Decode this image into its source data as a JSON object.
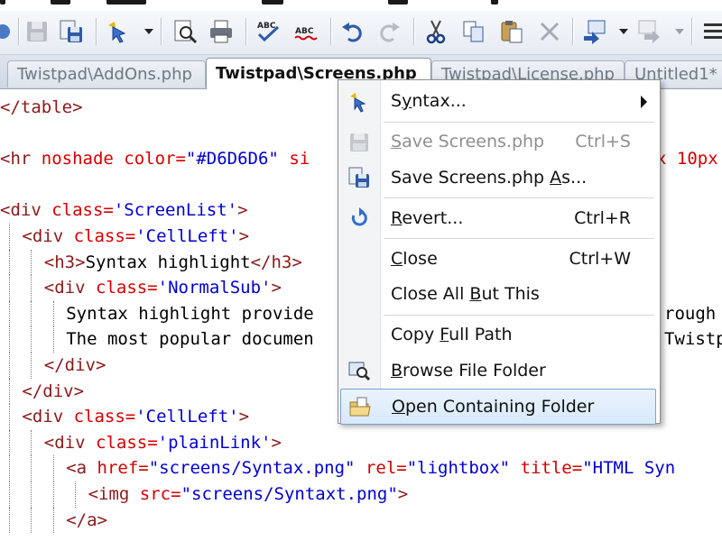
{
  "toolbar": {
    "buttons": [
      {
        "name": "save-icon",
        "state": "disabled"
      },
      {
        "name": "save-all-icon",
        "state": "enabled"
      },
      {
        "name": "syntax-icon",
        "state": "enabled"
      },
      {
        "name": "print-preview-icon",
        "state": "enabled"
      },
      {
        "name": "print-icon",
        "state": "enabled"
      },
      {
        "name": "spell-check-icon",
        "state": "enabled"
      },
      {
        "name": "spell-check-alt-icon",
        "state": "enabled"
      },
      {
        "name": "undo-icon",
        "state": "enabled"
      },
      {
        "name": "redo-icon",
        "state": "disabled"
      },
      {
        "name": "cut-icon",
        "state": "enabled"
      },
      {
        "name": "copy-icon",
        "state": "enabled"
      },
      {
        "name": "paste-icon",
        "state": "enabled"
      },
      {
        "name": "delete-icon",
        "state": "disabled"
      },
      {
        "name": "convert-icon",
        "state": "enabled"
      },
      {
        "name": "convert-alt-icon",
        "state": "disabled"
      },
      {
        "name": "more-icon",
        "state": "enabled"
      }
    ]
  },
  "tabs": [
    {
      "label": "Twistpad\\AddOns.php",
      "active": false
    },
    {
      "label": "Twistpad\\Screens.php",
      "active": true
    },
    {
      "label": "Twistpad\\License.php",
      "active": false
    },
    {
      "label": "Untitled1*",
      "active": false
    }
  ],
  "editor": {
    "lines": [
      {
        "indent": 0,
        "parts": [
          {
            "t": "tag",
            "s": "</table>"
          }
        ]
      },
      {
        "indent": 0,
        "parts": []
      },
      {
        "indent": 0,
        "parts": [
          {
            "t": "tag",
            "s": "<hr "
          },
          {
            "t": "attr",
            "s": "noshade "
          },
          {
            "t": "attr",
            "s": "color="
          },
          {
            "t": "val",
            "s": "\"#D6D6D6\" "
          },
          {
            "t": "attr",
            "s": "si"
          }
        ],
        "tail": "x 10px"
      },
      {
        "indent": 0,
        "parts": []
      },
      {
        "indent": 0,
        "parts": [
          {
            "t": "tag",
            "s": "<div "
          },
          {
            "t": "attr",
            "s": "class="
          },
          {
            "t": "val",
            "s": "'ScreenList'"
          },
          {
            "t": "tag",
            "s": ">"
          }
        ]
      },
      {
        "indent": 1,
        "parts": [
          {
            "t": "tag",
            "s": "<div "
          },
          {
            "t": "attr",
            "s": "class="
          },
          {
            "t": "val",
            "s": "'CellLeft'"
          },
          {
            "t": "tag",
            "s": ">"
          }
        ]
      },
      {
        "indent": 2,
        "parts": [
          {
            "t": "tag",
            "s": "<h3>"
          },
          {
            "t": "txt",
            "s": "Syntax highlight"
          },
          {
            "t": "tag",
            "s": "</h3>"
          }
        ]
      },
      {
        "indent": 2,
        "parts": [
          {
            "t": "tag",
            "s": "<div "
          },
          {
            "t": "attr",
            "s": "class="
          },
          {
            "t": "val",
            "s": "'NormalSub'"
          },
          {
            "t": "tag",
            "s": ">"
          }
        ]
      },
      {
        "indent": 3,
        "parts": [
          {
            "t": "txt",
            "s": "Syntax highlight provide"
          }
        ],
        "tail": "rough"
      },
      {
        "indent": 3,
        "parts": [
          {
            "t": "txt",
            "s": "The most popular documen"
          }
        ],
        "tail": "Twistp"
      },
      {
        "indent": 2,
        "parts": [
          {
            "t": "tag",
            "s": "</div>"
          }
        ]
      },
      {
        "indent": 1,
        "parts": [
          {
            "t": "tag",
            "s": "</div>"
          }
        ]
      },
      {
        "indent": 1,
        "parts": [
          {
            "t": "tag",
            "s": "<div "
          },
          {
            "t": "attr",
            "s": "class="
          },
          {
            "t": "val",
            "s": "'CellLeft'"
          },
          {
            "t": "tag",
            "s": ">"
          }
        ]
      },
      {
        "indent": 2,
        "parts": [
          {
            "t": "tag",
            "s": "<div "
          },
          {
            "t": "attr",
            "s": "class="
          },
          {
            "t": "val",
            "s": "'plainLink'"
          },
          {
            "t": "tag",
            "s": ">"
          }
        ]
      },
      {
        "indent": 3,
        "parts": [
          {
            "t": "tag",
            "s": "<a "
          },
          {
            "t": "attr",
            "s": "href="
          },
          {
            "t": "val",
            "s": "\"screens/Syntax.png\" "
          },
          {
            "t": "attr",
            "s": "rel="
          },
          {
            "t": "val",
            "s": "\"lightbox\" "
          },
          {
            "t": "attr",
            "s": "title="
          },
          {
            "t": "val",
            "s": "\"HTML Syn"
          }
        ]
      },
      {
        "indent": 4,
        "parts": [
          {
            "t": "tag",
            "s": "<img "
          },
          {
            "t": "attr",
            "s": "src="
          },
          {
            "t": "val",
            "s": "\"screens/Syntaxt.png\""
          },
          {
            "t": "tag",
            "s": ">"
          }
        ]
      },
      {
        "indent": 3,
        "parts": [
          {
            "t": "tag",
            "s": "</a>"
          }
        ]
      }
    ]
  },
  "context_menu": {
    "items": [
      {
        "kind": "item",
        "name": "menu-item-syntax",
        "icon": "syntax-icon",
        "pre": "S",
        "u": "y",
        "post": "ntax...",
        "shortcut": "",
        "submenu": true,
        "disabled": false,
        "highlight": false
      },
      {
        "kind": "sep"
      },
      {
        "kind": "item",
        "name": "menu-item-save",
        "icon": "save-icon",
        "pre": "",
        "u": "S",
        "post": "ave Screens.php",
        "shortcut": "Ctrl+S",
        "submenu": false,
        "disabled": true,
        "highlight": false
      },
      {
        "kind": "item",
        "name": "menu-item-save-as",
        "icon": "save-as-icon",
        "pre": "Save Screens.php ",
        "u": "A",
        "post": "s...",
        "shortcut": "",
        "submenu": false,
        "disabled": false,
        "highlight": false
      },
      {
        "kind": "sep"
      },
      {
        "kind": "item",
        "name": "menu-item-revert",
        "icon": "revert-icon",
        "pre": "",
        "u": "R",
        "post": "evert...",
        "shortcut": "Ctrl+R",
        "submenu": false,
        "disabled": false,
        "highlight": false
      },
      {
        "kind": "sep"
      },
      {
        "kind": "item",
        "name": "menu-item-close",
        "icon": "",
        "pre": "",
        "u": "C",
        "post": "lose",
        "shortcut": "Ctrl+W",
        "submenu": false,
        "disabled": false,
        "highlight": false
      },
      {
        "kind": "item",
        "name": "menu-item-close-all-but-this",
        "icon": "",
        "pre": "Close All ",
        "u": "B",
        "post": "ut This",
        "shortcut": "",
        "submenu": false,
        "disabled": false,
        "highlight": false
      },
      {
        "kind": "sep"
      },
      {
        "kind": "item",
        "name": "menu-item-copy-full-path",
        "icon": "",
        "pre": "Copy ",
        "u": "F",
        "post": "ull Path",
        "shortcut": "",
        "submenu": false,
        "disabled": false,
        "highlight": false
      },
      {
        "kind": "item",
        "name": "menu-item-browse-file-folder",
        "icon": "browse-folder-icon",
        "pre": "",
        "u": "B",
        "post": "rowse File Folder",
        "shortcut": "",
        "submenu": false,
        "disabled": false,
        "highlight": false
      },
      {
        "kind": "item",
        "name": "menu-item-open-containing-folder",
        "icon": "open-folder-icon",
        "pre": "",
        "u": "O",
        "post": "pen Containing Folder",
        "shortcut": "",
        "submenu": false,
        "disabled": false,
        "highlight": true
      }
    ]
  },
  "colors": {
    "tag": "#8b1a1a",
    "attribute": "#d40000",
    "value": "#0000d0",
    "highlight_border": "#7da2ce"
  }
}
